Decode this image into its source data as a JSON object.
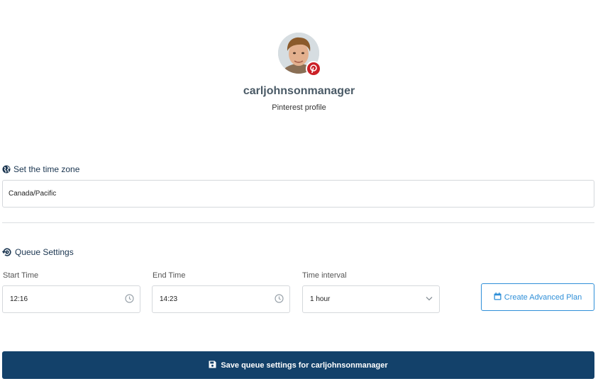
{
  "profile": {
    "username": "carljohnsonmanager",
    "subtitle": "Pinterest profile",
    "network_icon": "pinterest-icon",
    "brand_color": "#cb2027"
  },
  "timezone": {
    "title": "Set the time zone",
    "icon": "globe-icon",
    "value": "Canada/Pacific"
  },
  "queue": {
    "title": "Queue Settings",
    "icon": "refresh-clock-icon",
    "start_time": {
      "label": "Start Time",
      "value": "12:16",
      "icon": "clock-icon"
    },
    "end_time": {
      "label": "End Time",
      "value": "14:23",
      "icon": "clock-icon"
    },
    "interval": {
      "label": "Time interval",
      "value": "1 hour",
      "icon": "chevron-down-icon"
    },
    "advanced_button": {
      "label": "Create Advanced Plan",
      "icon": "calendar-icon",
      "color": "#2f8fd8"
    }
  },
  "save_button": {
    "label": "Save queue settings for carljohnsonmanager",
    "icon": "floppy-disk-icon",
    "color": "#13416a"
  }
}
